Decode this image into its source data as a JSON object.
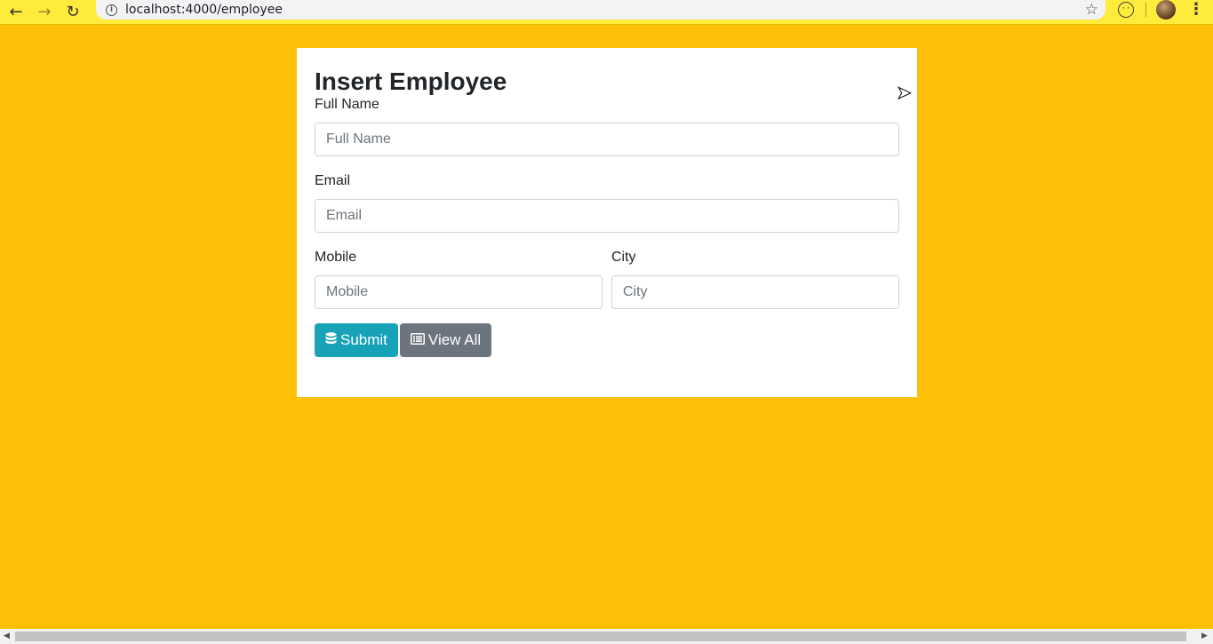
{
  "browser": {
    "back_glyph": "←",
    "forward_glyph": "→",
    "reload_glyph": "↻",
    "url": "localhost:4000/employee",
    "star_glyph": "☆",
    "menu_glyph": "⋮"
  },
  "form": {
    "title": "Insert Employee",
    "full_name": {
      "label": "Full Name",
      "placeholder": "Full Name",
      "value": ""
    },
    "email": {
      "label": "Email",
      "placeholder": "Email",
      "value": ""
    },
    "mobile": {
      "label": "Mobile",
      "placeholder": "Mobile",
      "value": ""
    },
    "city": {
      "label": "City",
      "placeholder": "City",
      "value": ""
    },
    "submit_label": "Submit",
    "view_all_label": "View All"
  },
  "icons": {
    "submit": "database-icon",
    "view_all": "list-alt-icon"
  },
  "colors": {
    "page_background": "#ffc107",
    "submit_button": "#17a2b8",
    "view_all_button": "#6c757d"
  }
}
